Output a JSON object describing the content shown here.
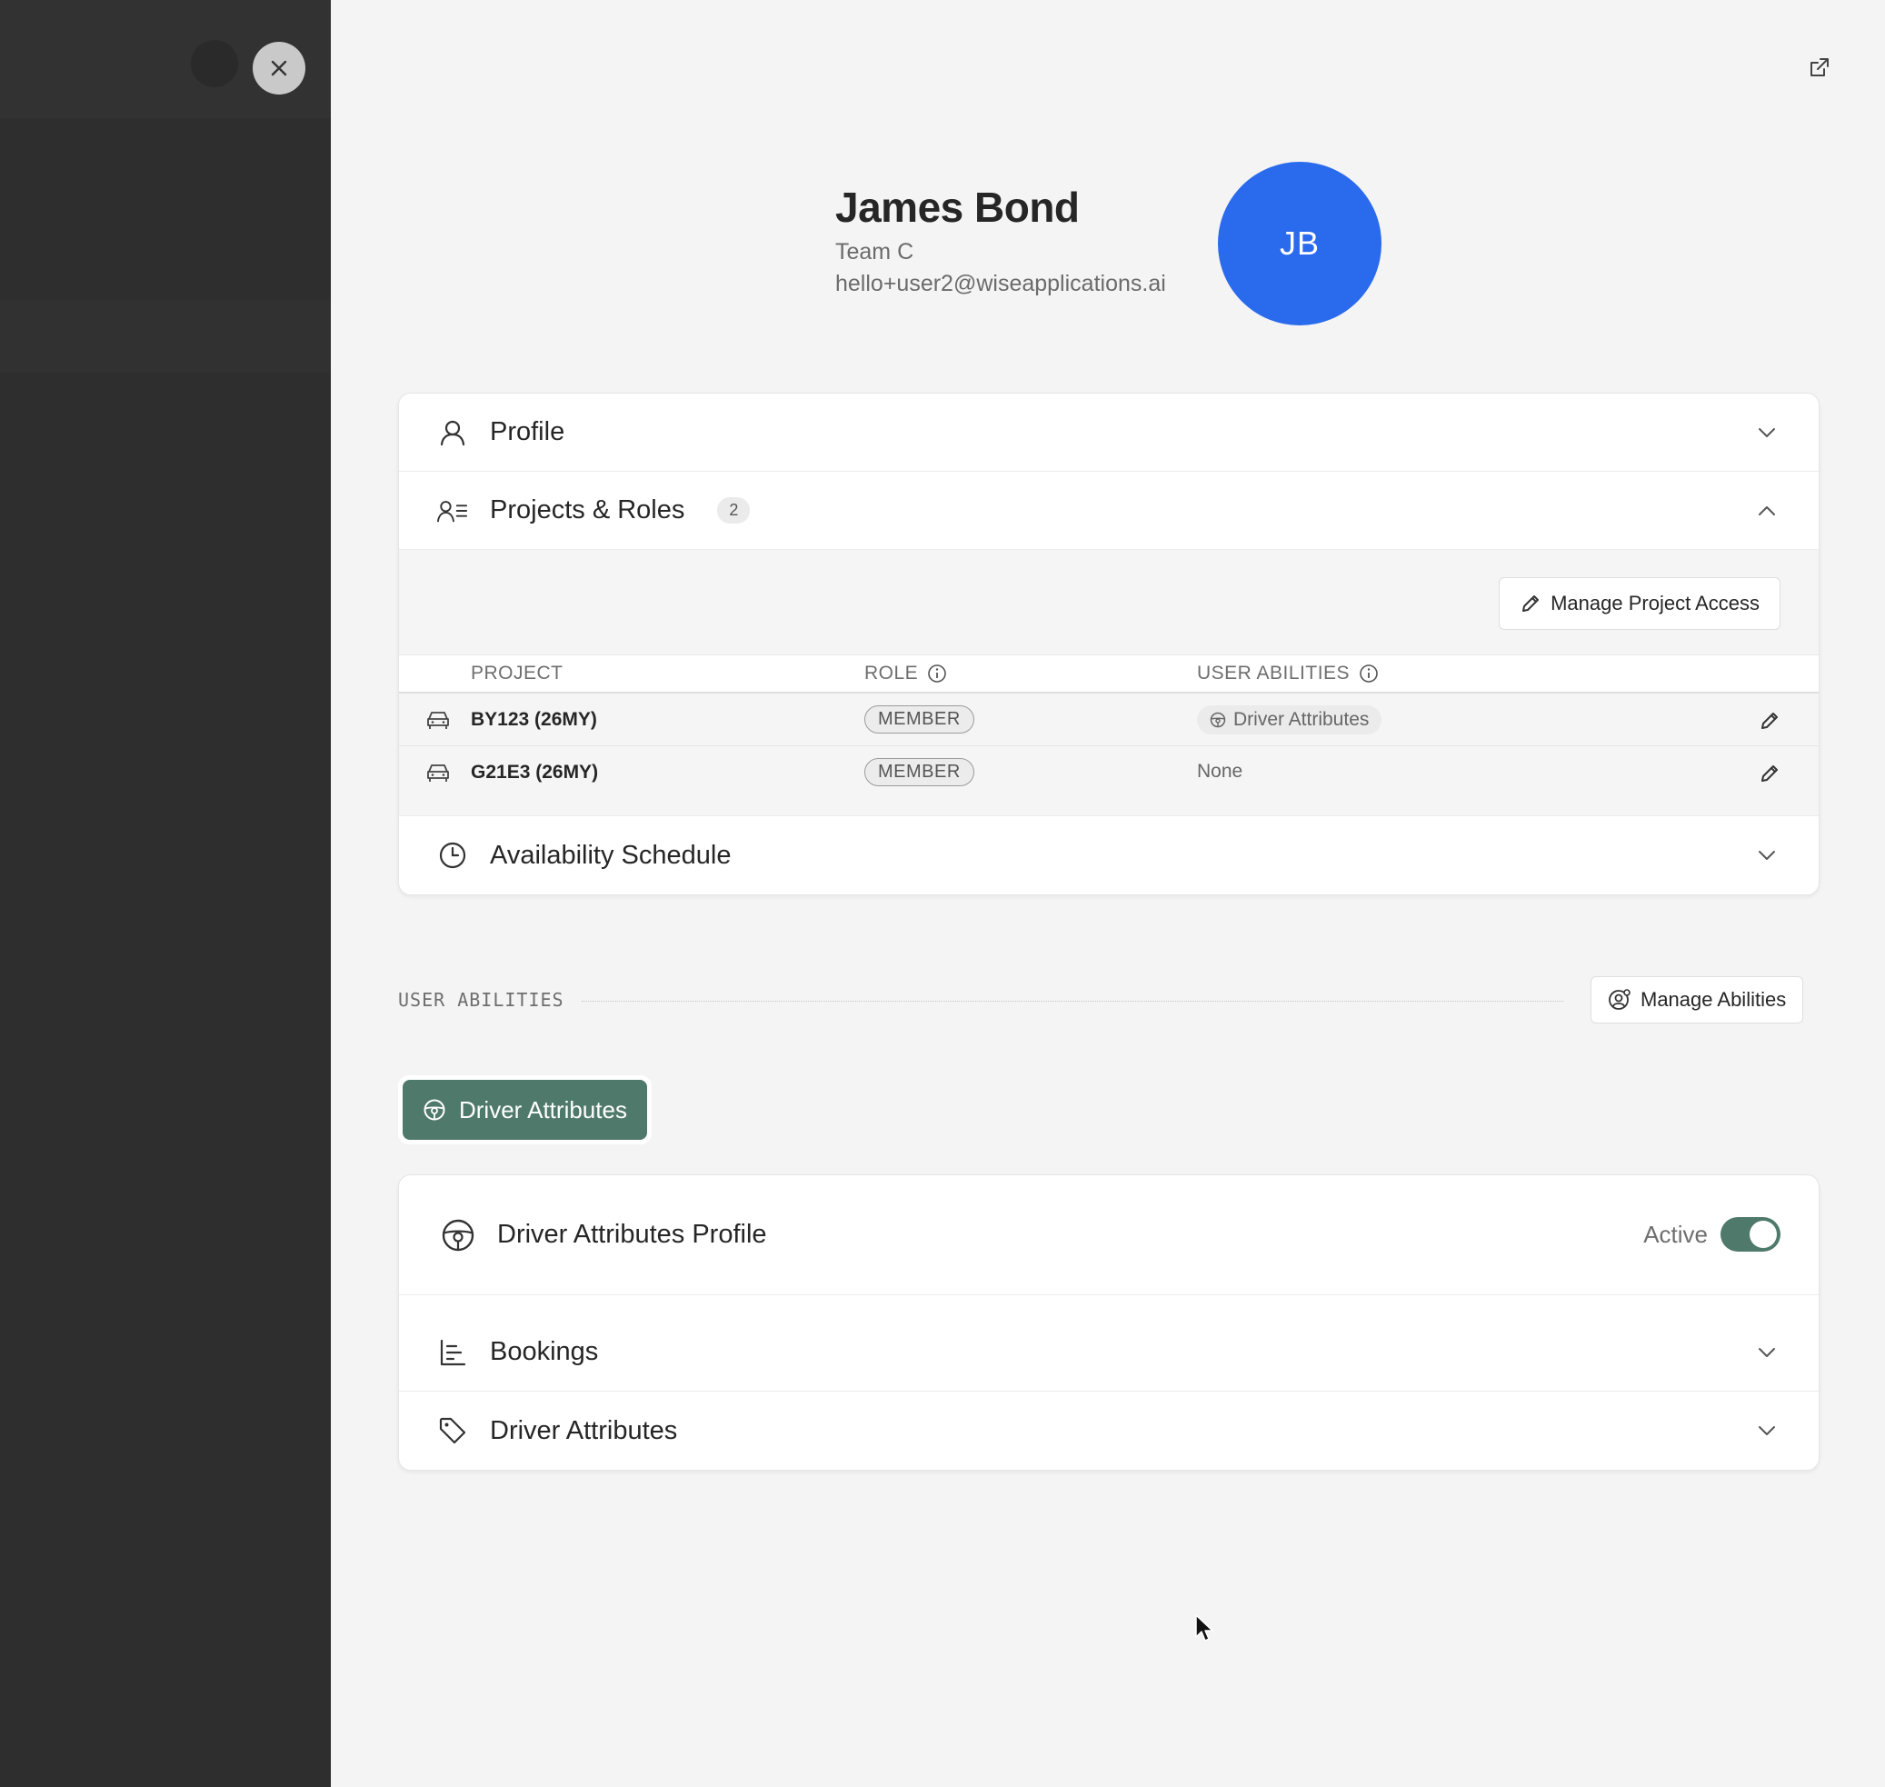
{
  "header": {
    "name": "James Bond",
    "team": "Team C",
    "email": "hello+user2@wiseapplications.ai",
    "initials": "JB",
    "avatar_color": "#2a6aec"
  },
  "icons": {
    "close": "close-icon",
    "external": "external-link-icon",
    "profile": "user-icon",
    "projects": "user-list-icon",
    "schedule": "clock-icon",
    "car": "car-icon",
    "steering": "steering-wheel-icon",
    "bookings": "chart-list-icon",
    "tag": "tag-icon",
    "edit": "pencil-icon",
    "info": "info-icon",
    "user_gear": "user-gear-icon"
  },
  "accordion": {
    "profile": {
      "title": "Profile"
    },
    "projects": {
      "title": "Projects & Roles",
      "count": "2",
      "manage_label": "Manage Project Access",
      "columns": {
        "project": "PROJECT",
        "role": "ROLE",
        "abilities": "USER ABILITIES"
      },
      "rows": [
        {
          "project": "BY123 (26MY)",
          "role": "MEMBER",
          "abilities": "Driver Attributes"
        },
        {
          "project": "G21E3 (26MY)",
          "role": "MEMBER",
          "abilities": "None"
        }
      ]
    },
    "schedule": {
      "title": "Availability Schedule"
    }
  },
  "abilities": {
    "section_label": "USER ABILITIES",
    "manage_label": "Manage Abilities",
    "tab_label": "Driver Attributes",
    "accent": "#4f7a6b"
  },
  "driver_card": {
    "title": "Driver Attributes Profile",
    "status_label": "Active",
    "active": true,
    "sections": [
      {
        "title": "Bookings"
      },
      {
        "title": "Driver Attributes"
      }
    ]
  }
}
